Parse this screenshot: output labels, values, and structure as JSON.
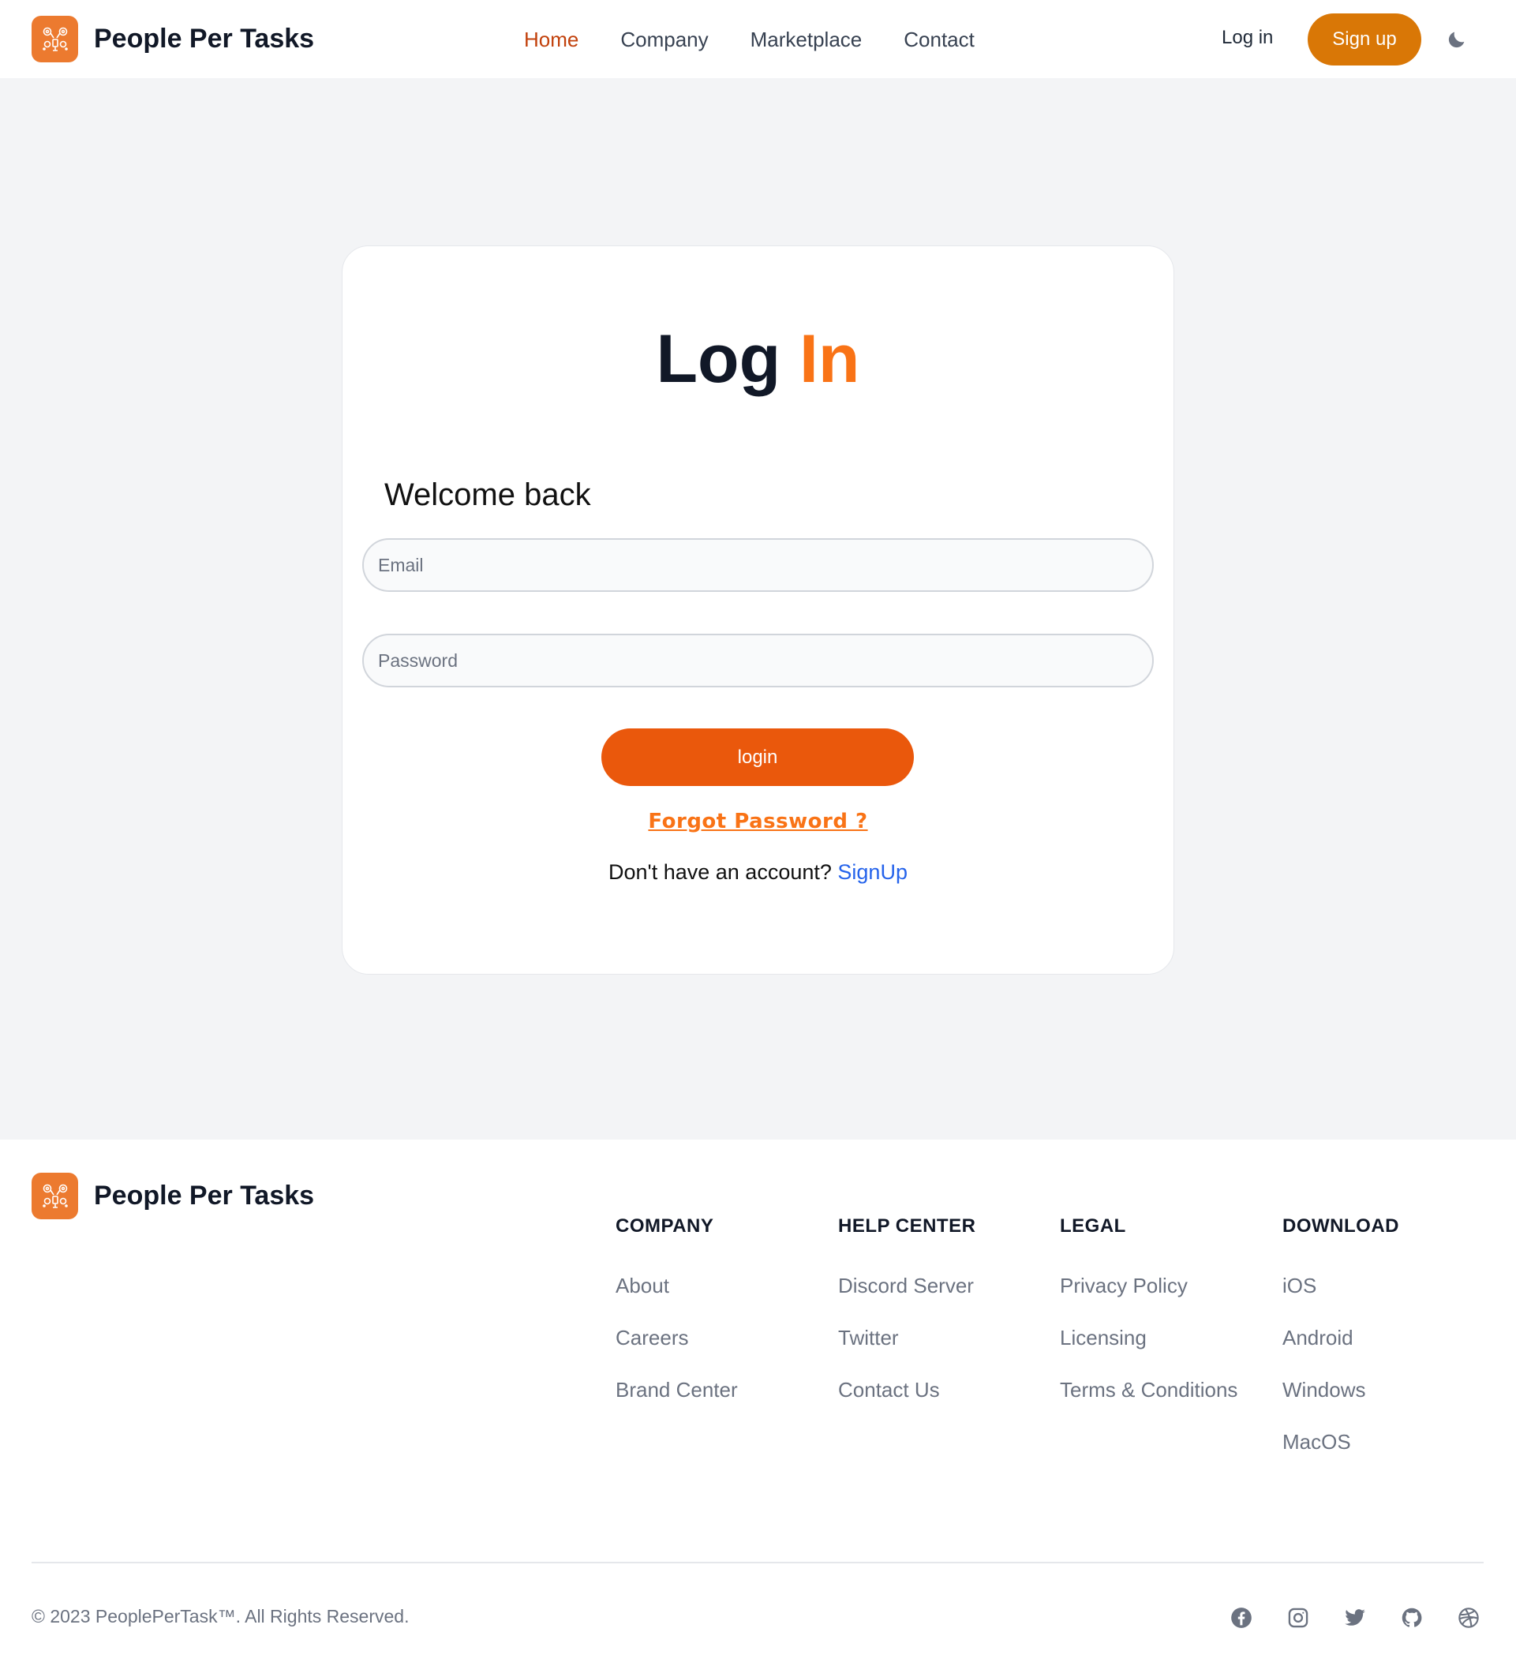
{
  "header": {
    "brand_name": "People Per Tasks",
    "nav": [
      "Home",
      "Company",
      "Marketplace",
      "Contact"
    ],
    "active_nav": "Home",
    "login_label": "Log in",
    "signup_label": "Sign up",
    "theme_toggle_icon": "moon-icon"
  },
  "login_card": {
    "title_main": "Log",
    "title_accent": "In",
    "welcome": "Welcome back",
    "email_placeholder": "Email",
    "email_value": "",
    "password_placeholder": "Password",
    "password_value": "",
    "login_button": "login",
    "forgot_password": "Forgot Password ?",
    "no_account_text": "Don't have an account?",
    "signup_link": "SignUp"
  },
  "footer": {
    "brand_name": "People Per Tasks",
    "columns": [
      {
        "heading": "COMPANY",
        "links": [
          "About",
          "Careers",
          "Brand Center"
        ]
      },
      {
        "heading": "HELP CENTER",
        "links": [
          "Discord Server",
          "Twitter",
          "Contact Us"
        ]
      },
      {
        "heading": "LEGAL",
        "links": [
          "Privacy Policy",
          "Licensing",
          "Terms & Conditions"
        ]
      },
      {
        "heading": "DOWNLOAD",
        "links": [
          "iOS",
          "Android",
          "Windows",
          "MacOS"
        ]
      }
    ],
    "copyright": "© 2023 PeoplePerTask™. All Rights Reserved.",
    "social_icons": [
      "facebook-icon",
      "instagram-icon",
      "twitter-icon",
      "github-icon",
      "dribbble-icon"
    ]
  },
  "colors": {
    "brand_orange": "#ec7a2f",
    "signup_button": "#d97706",
    "login_button": "#ea580c",
    "accent_text": "#f97316",
    "active_nav": "#c2410c",
    "link_blue": "#2563eb",
    "page_background": "#f3f4f6"
  }
}
